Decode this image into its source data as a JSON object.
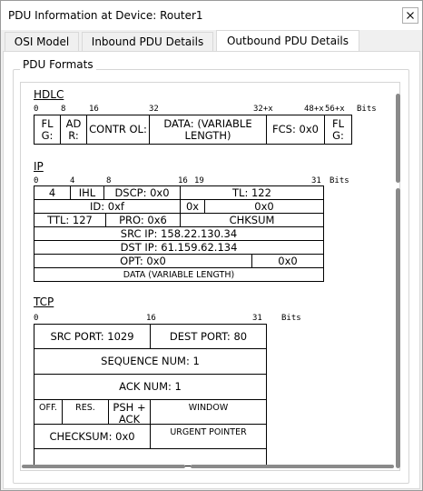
{
  "window": {
    "title": "PDU Information at Device: Router1",
    "close_symbol": "✕"
  },
  "tabs": [
    {
      "label": "OSI Model",
      "active": false
    },
    {
      "label": "Inbound PDU Details",
      "active": false
    },
    {
      "label": "Outbound PDU Details",
      "active": true
    }
  ],
  "group": {
    "label": "PDU Formats"
  },
  "hdlc": {
    "title": "HDLC",
    "ruler": [
      "0",
      "8",
      "16",
      "32",
      "32+x",
      "48+x",
      "56+x",
      "Bits"
    ],
    "fields": [
      {
        "label": "FL G:"
      },
      {
        "label": "AD R:"
      },
      {
        "label": "CONTR OL:"
      },
      {
        "label": "DATA: (VARIABLE LENGTH)"
      },
      {
        "label": "FCS: 0x0"
      },
      {
        "label": "FL G:"
      }
    ]
  },
  "ip": {
    "title": "IP",
    "ruler": [
      "0",
      "4",
      "8",
      "16",
      "19",
      "31",
      "Bits"
    ],
    "fields": {
      "version": "4",
      "ihl": "IHL",
      "dscp": "DSCP: 0x0",
      "tl": "TL: 122",
      "id": "ID: 0xf",
      "flags": "0x",
      "frag_offset": "0x0",
      "ttl": "TTL: 127",
      "pro": "PRO: 0x6",
      "checksum": "CHKSUM",
      "src_ip": "SRC IP: 158.22.130.34",
      "dst_ip": "DST IP: 61.159.62.134",
      "opt": "OPT: 0x0",
      "padding": "0x0",
      "data": "DATA (VARIABLE LENGTH)"
    }
  },
  "tcp": {
    "title": "TCP",
    "ruler": [
      "0",
      "16",
      "31",
      "Bits"
    ],
    "fields": {
      "src_port": "SRC PORT: 1029",
      "dest_port": "DEST PORT: 80",
      "seq": "SEQUENCE NUM: 1",
      "ack": "ACK NUM: 1",
      "off": "OFF.",
      "res": "RES.",
      "flags": "PSH + ACK",
      "window": "WINDOW",
      "checksum": "CHECKSUM: 0x0",
      "urgent": "URGENT POINTER"
    }
  },
  "scrollbars": {
    "vertical_position": 0.35,
    "horizontal_position": 0.45
  }
}
